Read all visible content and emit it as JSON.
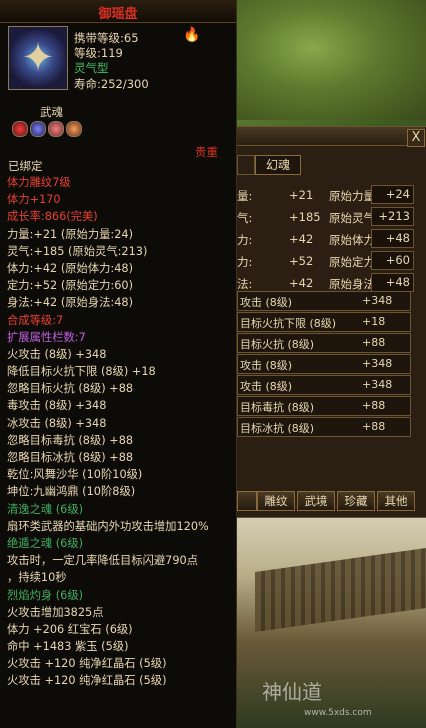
{
  "tooltip": {
    "title": "御瑶盘",
    "req_level": "携带等级:65",
    "level": "等级:119",
    "type": "灵气型",
    "lifespan": "寿命:252/300",
    "wuhun_label": "武魂",
    "precious": "贵重",
    "bound": "已绑定",
    "lines": [
      {
        "text": "体力雕纹7级",
        "color": "#e84030"
      },
      {
        "text": "体力+170",
        "color": "#e84030"
      },
      {
        "text": "成长率:866(完美)",
        "color": "#e84030"
      },
      {
        "text": "力量:+21 (原始力量:24)",
        "color": "#e8d8b0"
      },
      {
        "text": "灵气:+185 (原始灵气:213)",
        "color": "#e8d8b0"
      },
      {
        "text": "体力:+42 (原始体力:48)",
        "color": "#e8d8b0"
      },
      {
        "text": "定力:+52 (原始定力:60)",
        "color": "#e8d8b0"
      },
      {
        "text": "身法:+42 (原始身法:48)",
        "color": "#e8d8b0"
      },
      {
        "text": "合成等级:7",
        "color": "#e84030"
      },
      {
        "text": "扩展属性栏数:7",
        "color": "#c060e0"
      },
      {
        "text": "火攻击 (8级) +348",
        "color": "#e8d8b0"
      },
      {
        "text": "降低目标火抗下限 (8级) +18",
        "color": "#e8d8b0"
      },
      {
        "text": "忽略目标火抗 (8级) +88",
        "color": "#e8d8b0"
      },
      {
        "text": "毒攻击 (8级) +348",
        "color": "#e8d8b0"
      },
      {
        "text": "冰攻击 (8级) +348",
        "color": "#e8d8b0"
      },
      {
        "text": "忽略目标毒抗 (8级) +88",
        "color": "#e8d8b0"
      },
      {
        "text": "忽略目标冰抗 (8级) +88",
        "color": "#e8d8b0"
      },
      {
        "text": "乾位:风舞沙华 (10阶10级)",
        "color": "#e8d8b0"
      },
      {
        "text": "坤位:九幽鸿鼎 (10阶8级)",
        "color": "#e8d8b0"
      },
      {
        "text": "清逸之魂 (6级)",
        "color": "#40b060"
      },
      {
        "text": "扇环类武器的基础内外功攻击增加120%",
        "color": "#e8d8b0"
      },
      {
        "text": "绝遁之魂 (6级)",
        "color": "#40b060"
      },
      {
        "text": "攻击时，一定几率降低目标闪避790点",
        "color": "#e8d8b0"
      },
      {
        "text": "，持续10秒",
        "color": "#e8d8b0"
      },
      {
        "text": "烈焰灼身 (6级)",
        "color": "#40b060"
      },
      {
        "text": "火攻击增加3825点",
        "color": "#e8d8b0"
      },
      {
        "text": "体力 +206 红宝石 (6级)",
        "color": "#e8d8b0"
      },
      {
        "text": "命中 +1483 紫玉 (5级)",
        "color": "#e8d8b0"
      },
      {
        "text": "火攻击 +120 纯净红晶石 (5级)",
        "color": "#e8d8b0"
      },
      {
        "text": "火攻击 +120 纯净红晶石 (5级)",
        "color": "#e8d8b0"
      }
    ]
  },
  "right_panel": {
    "tab_label": "幻魂",
    "close": "X",
    "attrs": [
      {
        "a": "量:",
        "b": "+21",
        "c": "原始力量",
        "d": "+24"
      },
      {
        "a": "气:",
        "b": "+185",
        "c": "原始灵气",
        "d": "+213"
      },
      {
        "a": "力:",
        "b": "+42",
        "c": "原始体力",
        "d": "+48"
      },
      {
        "a": "力:",
        "b": "+52",
        "c": "原始定力",
        "d": "+60"
      },
      {
        "a": "法:",
        "b": "+42",
        "c": "原始身法",
        "d": "+48"
      }
    ],
    "effects": [
      {
        "n": "攻击 (8级)",
        "v": "+348"
      },
      {
        "n": "目标火抗下限 (8级)",
        "v": "+18"
      },
      {
        "n": "目标火抗 (8级)",
        "v": "+88"
      },
      {
        "n": "攻击 (8级)",
        "v": "+348"
      },
      {
        "n": "攻击 (8级)",
        "v": "+348"
      },
      {
        "n": "目标毒抗 (8级)",
        "v": "+88"
      },
      {
        "n": "目标冰抗 (8级)",
        "v": "+88"
      }
    ],
    "buttons": [
      "雕纹",
      "武境",
      "珍藏",
      "其他"
    ]
  },
  "watermark": {
    "brand": "神仙道",
    "url": "www.5xds.com"
  }
}
